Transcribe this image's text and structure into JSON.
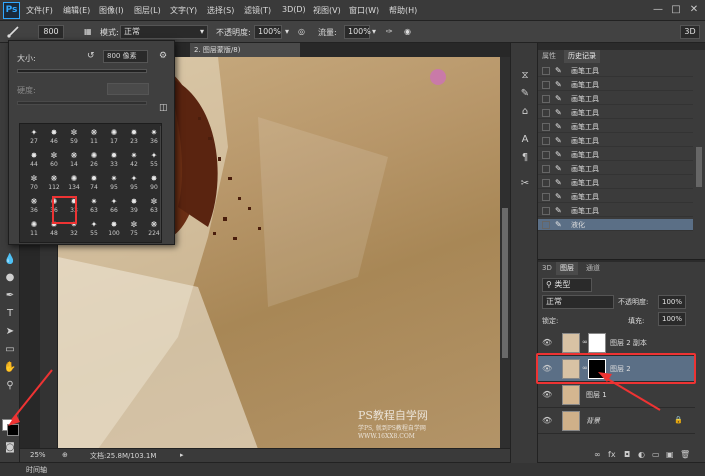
{
  "app": {
    "logo": "Ps"
  },
  "menu": {
    "items": [
      "文件(F)",
      "编辑(E)",
      "图像(I)",
      "图层(L)",
      "文字(Y)",
      "选择(S)",
      "滤镜(T)",
      "3D(D)",
      "视图(V)",
      "窗口(W)",
      "帮助(H)"
    ],
    "window_buttons": [
      "—",
      "□",
      "✕"
    ]
  },
  "options": {
    "brush_size": "800",
    "mode_label": "模式:",
    "mode_value": "正常",
    "opacity_label": "不透明度:",
    "opacity_value": "100%",
    "flow_label": "流量:",
    "flow_value": "100%",
    "workspace": "3D"
  },
  "brush_popup": {
    "size_label": "大小:",
    "size_value": "800 像素",
    "hardness_label": "硬度:",
    "brush_rows": [
      [
        "27",
        "46",
        "59",
        "11",
        "17",
        "23",
        "36"
      ],
      [
        "44",
        "60",
        "14",
        "26",
        "33",
        "42",
        "55"
      ],
      [
        "70",
        "112",
        "134",
        "74",
        "95",
        "95",
        "90"
      ],
      [
        "36",
        "36",
        "33",
        "63",
        "66",
        "39",
        "63"
      ],
      [
        "11",
        "48",
        "32",
        "55",
        "100",
        "75",
        "224"
      ]
    ],
    "selected_brush": "66"
  },
  "document": {
    "tab_title": "2. 图层蒙版/8)",
    "zoom": "25%",
    "doc_info": "文档:25.8M/103.1M",
    "watermark_title": "PS教程自学网",
    "watermark_sub": "学PS, 就到PS教程自学网",
    "watermark_url": "WWW.16XX8.COM"
  },
  "timeline": {
    "label": "时间轴"
  },
  "history_panel": {
    "tabs": [
      "属性",
      "历史记录"
    ],
    "rows": [
      "画笔工具",
      "画笔工具",
      "画笔工具",
      "画笔工具",
      "画笔工具",
      "画笔工具",
      "画笔工具",
      "画笔工具",
      "画笔工具",
      "画笔工具",
      "画笔工具",
      "液化"
    ]
  },
  "layers_panel": {
    "tabs": [
      "3D",
      "图层",
      "通道"
    ],
    "filter_label": "类型",
    "blend_mode": "正常",
    "opacity_label": "不透明度:",
    "opacity_value": "100%",
    "lock_label": "锁定:",
    "fill_label": "填充:",
    "fill_value": "100%",
    "layers": [
      {
        "name": "图层 2 副本"
      },
      {
        "name": "图层 2"
      },
      {
        "name": "图层 1"
      },
      {
        "name": "背景"
      }
    ]
  },
  "colors": {
    "accent_red": "#e33333",
    "selection_blue": "#5b6f86"
  }
}
